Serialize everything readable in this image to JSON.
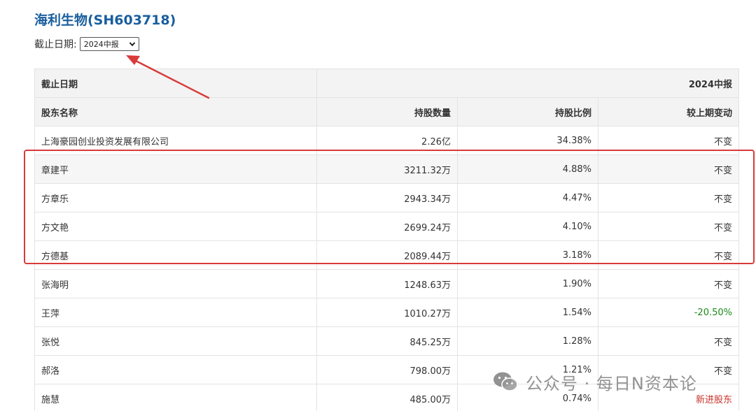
{
  "title": "海利生物(SH603718)",
  "date_filter": {
    "label": "截止日期:",
    "selected": "2024中报"
  },
  "table": {
    "period_header": "截止日期",
    "period_value": "2024中报",
    "columns": [
      "股东名称",
      "持股数量",
      "持股比例",
      "较上期变动"
    ],
    "rows": [
      {
        "name": "上海豪园创业投资发展有限公司",
        "shares": "2.26亿",
        "ratio": "34.38%",
        "change": "不变",
        "change_type": "same"
      },
      {
        "name": "章建平",
        "shares": "3211.32万",
        "ratio": "4.88%",
        "change": "不变",
        "change_type": "same"
      },
      {
        "name": "方章乐",
        "shares": "2943.34万",
        "ratio": "4.47%",
        "change": "不变",
        "change_type": "same"
      },
      {
        "name": "方文艳",
        "shares": "2699.24万",
        "ratio": "4.10%",
        "change": "不变",
        "change_type": "same"
      },
      {
        "name": "方德基",
        "shares": "2089.44万",
        "ratio": "3.18%",
        "change": "不变",
        "change_type": "same"
      },
      {
        "name": "张海明",
        "shares": "1248.63万",
        "ratio": "1.90%",
        "change": "不变",
        "change_type": "same"
      },
      {
        "name": "王萍",
        "shares": "1010.27万",
        "ratio": "1.54%",
        "change": "-20.50%",
        "change_type": "decrease"
      },
      {
        "name": "张悦",
        "shares": "845.25万",
        "ratio": "1.28%",
        "change": "不变",
        "change_type": "same"
      },
      {
        "name": "郝洛",
        "shares": "798.00万",
        "ratio": "1.21%",
        "change": "不变",
        "change_type": "same"
      },
      {
        "name": "施慧",
        "shares": "485.00万",
        "ratio": "0.74%",
        "change": "新进股东",
        "change_type": "new"
      }
    ]
  },
  "watermark": {
    "text": "公众号 · 每日N资本论",
    "icon": "wechat-icon"
  },
  "colors": {
    "title": "#1a5e9e",
    "annotation_red": "#d93a3a",
    "decrease_green": "#1a8a1a",
    "new_red": "#c8322a"
  }
}
